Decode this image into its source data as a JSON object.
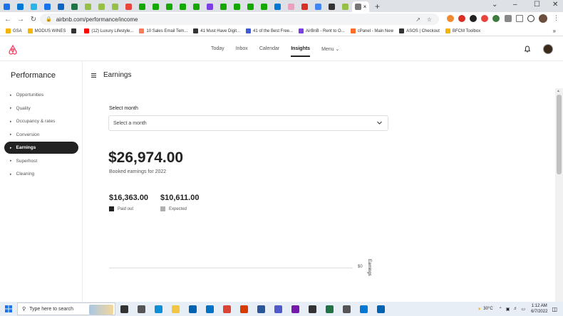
{
  "browser": {
    "tabs": [
      {
        "icon": "cloud-icon",
        "color": "#1a73e8"
      },
      {
        "icon": "outlook-icon",
        "color": "#0078d4"
      },
      {
        "icon": "snowflake-icon",
        "color": "#29b5e8"
      },
      {
        "icon": "cloud-icon",
        "color": "#1a73e8"
      },
      {
        "icon": "linkedin-icon",
        "color": "#0a66c2"
      },
      {
        "icon": "excel-icon",
        "color": "#217346"
      },
      {
        "icon": "shopify-icon",
        "color": "#96bf48"
      },
      {
        "icon": "shopify-icon",
        "color": "#96bf48"
      },
      {
        "icon": "shopify-icon",
        "color": "#96bf48"
      },
      {
        "icon": "flag-icon",
        "color": "#e8453c"
      },
      {
        "icon": "upwork-icon",
        "color": "#14a800"
      },
      {
        "icon": "upwork-icon",
        "color": "#14a800"
      },
      {
        "icon": "upwork-icon",
        "color": "#14a800"
      },
      {
        "icon": "upwork-icon",
        "color": "#14a800"
      },
      {
        "icon": "upwork-icon",
        "color": "#14a800"
      },
      {
        "icon": "notion-icon",
        "color": "#7b3fe4"
      },
      {
        "icon": "upwork-icon",
        "color": "#14a800"
      },
      {
        "icon": "upwork-icon",
        "color": "#14a800"
      },
      {
        "icon": "upwork-icon",
        "color": "#14a800"
      },
      {
        "icon": "upwork-icon",
        "color": "#14a800"
      },
      {
        "icon": "outlook-icon",
        "color": "#0078d4"
      },
      {
        "icon": "heart-icon",
        "color": "#e9a1c0"
      },
      {
        "icon": "gmail-icon",
        "color": "#d93025"
      },
      {
        "icon": "google-icon",
        "color": "#4285f4"
      },
      {
        "icon": "circle-icon",
        "color": "#333333"
      },
      {
        "icon": "shopify-icon",
        "color": "#96bf48"
      },
      {
        "icon": "page-icon",
        "color": "#777777"
      }
    ],
    "active_tab_index": 26,
    "url": "airbnb.com/performance/income",
    "bookmarks": [
      {
        "label": "GSA",
        "color": "#f4b400"
      },
      {
        "label": "MODUS WINES",
        "color": "#f4b400"
      },
      {
        "label": "",
        "color": "#333333"
      },
      {
        "label": "(12) Luxury Lifestyle...",
        "color": "#ff0000"
      },
      {
        "label": "10 Sales Email Tem...",
        "color": "#ff7a59"
      },
      {
        "label": "41 Must Have Digit...",
        "color": "#333333"
      },
      {
        "label": "41 of the Best Free...",
        "color": "#3b5bdb"
      },
      {
        "label": "AirBnB - Rent to O...",
        "color": "#7b3fe4"
      },
      {
        "label": "cPanel - Main New",
        "color": "#ff6c2c"
      },
      {
        "label": "ASOS | Checkout",
        "color": "#333333"
      },
      {
        "label": "BFCM Toolbox",
        "color": "#f4b400"
      }
    ]
  },
  "header": {
    "nav": [
      "Today",
      "Inbox",
      "Calendar",
      "Insights",
      "Menu"
    ],
    "active_nav": "Insights"
  },
  "sidebar": {
    "title": "Performance",
    "items": [
      {
        "label": "Opportunities",
        "active": false
      },
      {
        "label": "Quality",
        "active": false
      },
      {
        "label": "Occupancy & rates",
        "active": false
      },
      {
        "label": "Conversion",
        "active": false
      },
      {
        "label": "Earnings",
        "active": true
      },
      {
        "label": "Superhost",
        "active": false
      },
      {
        "label": "Cleaning",
        "active": false
      }
    ]
  },
  "main": {
    "title": "Earnings",
    "select_label": "Select month",
    "select_value": "Select a month",
    "total": "$26,974.00",
    "total_caption": "Booked earnings for 2022",
    "paid_out": {
      "amount": "$16,363.00",
      "label": "Paid out",
      "color": "#222222"
    },
    "expected": {
      "amount": "$10,611.00",
      "label": "Expected",
      "color": "#b0b0b0"
    }
  },
  "chart_data": {
    "type": "bar",
    "categories": [],
    "values": [],
    "ylabel": "Earnings",
    "ytick": "$0"
  },
  "taskbar": {
    "search_placeholder": "Type here to search",
    "weather": "30°C",
    "time": "1:12 AM",
    "date": "6/7/2022"
  }
}
